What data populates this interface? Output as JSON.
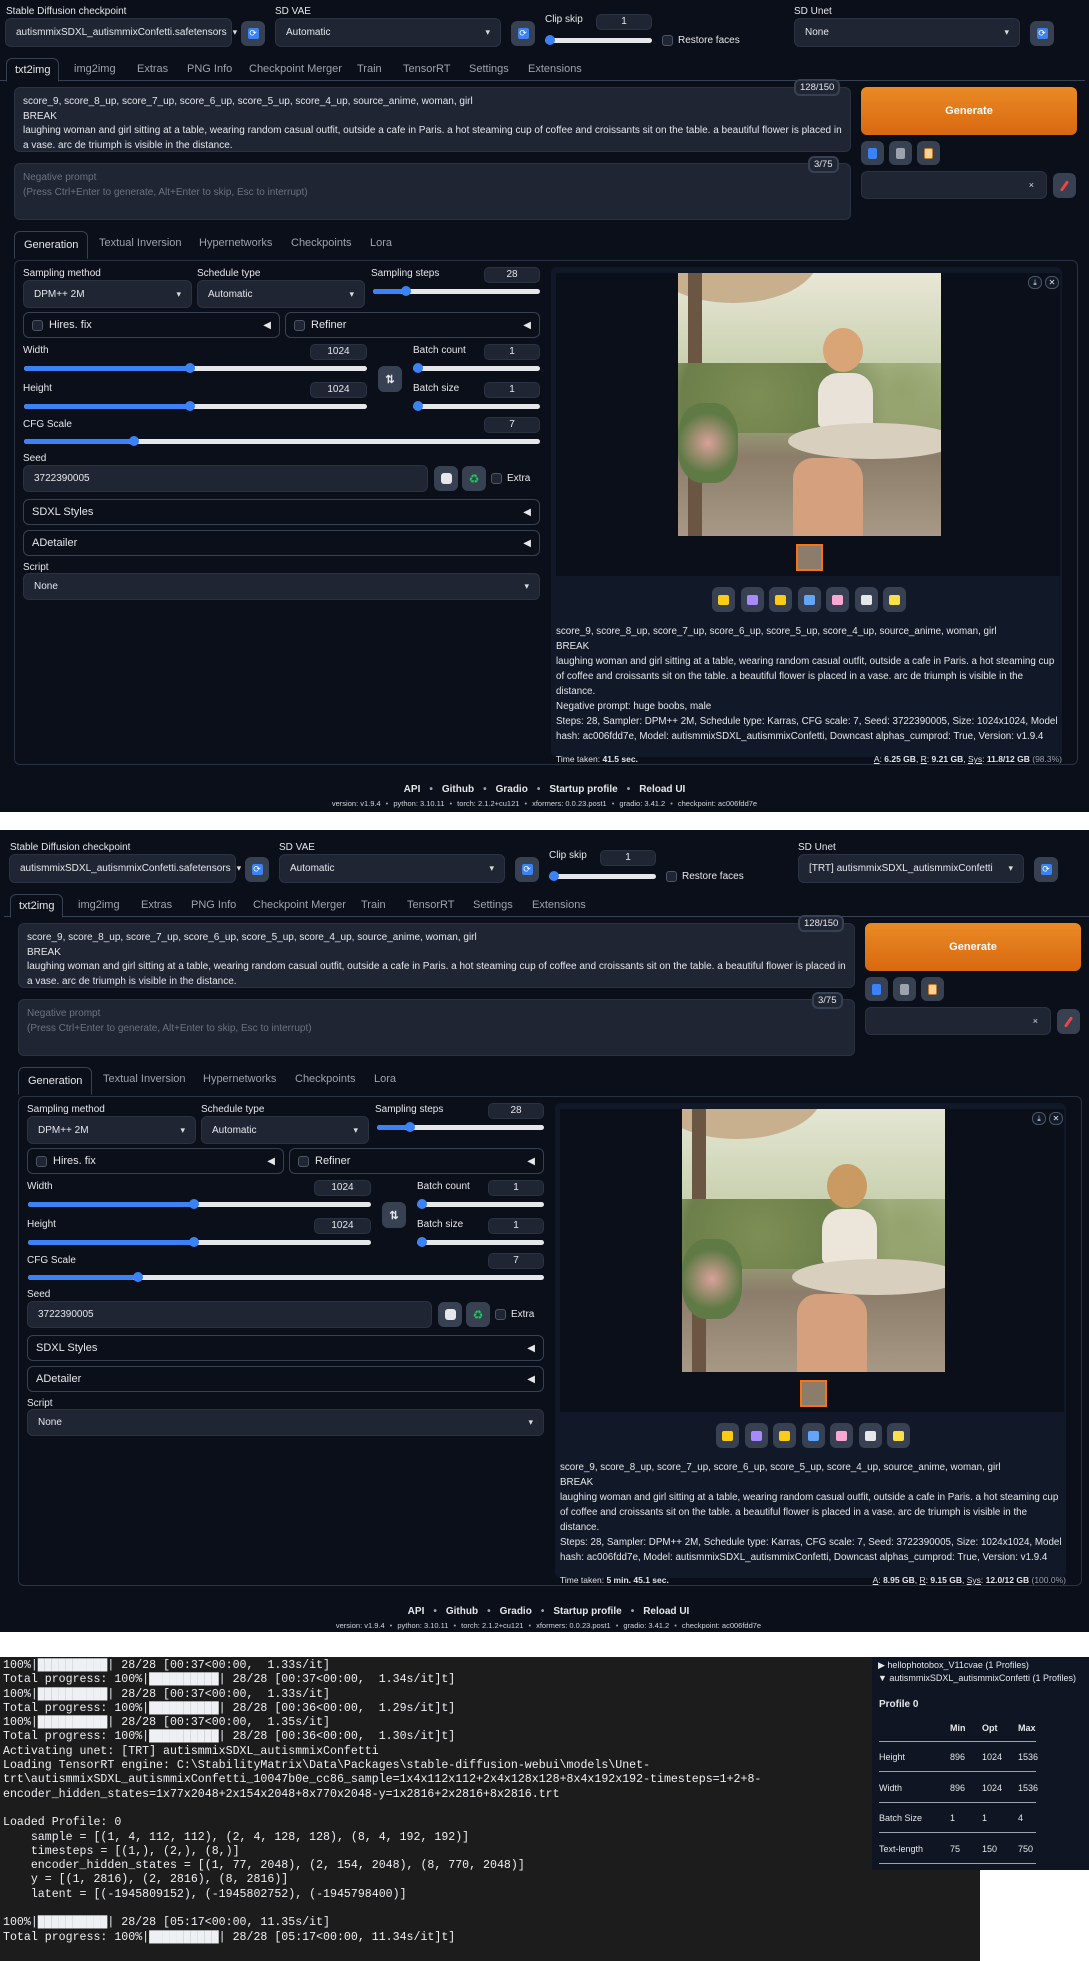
{
  "ui": {
    "checkpoint_label": "Stable Diffusion checkpoint",
    "vae_label": "SD VAE",
    "vae_value": "Automatic",
    "clip_skip_label": "Clip skip",
    "restore_faces_label": "Restore faces",
    "unet_label": "SD Unet",
    "tabs": [
      "txt2img",
      "img2img",
      "Extras",
      "PNG Info",
      "Checkpoint Merger",
      "Train",
      "TensorRT",
      "Settings",
      "Extensions"
    ],
    "prompt_counter": "128/150",
    "negative_counter": "3/75",
    "prompt_lines": [
      "score_9, score_8_up, score_7_up, score_6_up, score_5_up, score_4_up, source_anime, woman, girl",
      "BREAK",
      "laughing woman and girl sitting at a table,  wearing random casual outfit, outside a cafe in Paris. a hot steaming cup of coffee and croissants sit on the table. a beautiful flower is placed in a vase. arc de triumph is visible in the distance."
    ],
    "negative_placeholder_1": "Negative prompt",
    "negative_placeholder_2": "(Press Ctrl+Enter to generate, Alt+Enter to skip, Esc to interrupt)",
    "generate_label": "Generate",
    "style_clear": "×",
    "subtabs": [
      "Generation",
      "Textual Inversion",
      "Hypernetworks",
      "Checkpoints",
      "Lora"
    ],
    "sampling_method_label": "Sampling method",
    "sampling_method_value": "DPM++ 2M",
    "schedule_type_label": "Schedule type",
    "schedule_type_value": "Automatic",
    "sampling_steps_label": "Sampling steps",
    "hires_label": "Hires. fix",
    "refiner_label": "Refiner",
    "width_label": "Width",
    "height_label": "Height",
    "batch_count_label": "Batch count",
    "batch_size_label": "Batch size",
    "cfg_label": "CFG Scale",
    "seed_label": "Seed",
    "seed_value": "3722390005",
    "extra_label": "Extra",
    "sdxl_styles_label": "SDXL Styles",
    "adetailer_label": "ADetailer",
    "script_label": "Script",
    "script_value": "None",
    "time_label": "Time taken:",
    "mem_a": "A",
    "mem_r": "R",
    "mem_sys": "Sys",
    "footer_links": [
      "API",
      "Github",
      "Gradio",
      "Startup profile",
      "Reload UI"
    ],
    "footer_version": [
      "version: v1.9.4",
      "python: 3.10.11",
      "torch: 2.1.2+cu121",
      "xformers: 0.0.23.post1",
      "gradio: 3.41.2",
      "checkpoint: ac006fdd7e"
    ],
    "sliders": {
      "clip_skip": {
        "value": "1",
        "min": 1,
        "max": 12
      },
      "steps": {
        "value": "28",
        "min": 1,
        "max": 150
      },
      "width": {
        "value": "1024",
        "min": 64,
        "max": 2048
      },
      "height": {
        "value": "1024",
        "min": 64,
        "max": 2048
      },
      "batch_count": {
        "value": "1",
        "min": 1,
        "max": 100
      },
      "batch_size": {
        "value": "1",
        "min": 1,
        "max": 8
      },
      "cfg": {
        "value": "7",
        "min": 1,
        "max": 30
      }
    }
  },
  "panels": [
    {
      "checkpoint": "autismmixSDXL_autismmixConfetti.safetensors",
      "unet": "None",
      "info_lines": [
        "score_9, score_8_up, score_7_up, score_6_up, score_5_up, score_4_up, source_anime, woman, girl",
        "BREAK",
        "laughing woman and girl sitting at a table, wearing random casual outfit, outside a cafe in Paris. a hot steaming cup of coffee and croissants sit on the table. a beautiful flower is placed in a vase. arc de triumph is visible in the distance.",
        "Negative prompt: huge boobs, male",
        "Steps: 28, Sampler: DPM++ 2M, Schedule type: Karras, CFG scale: 7, Seed: 3722390005, Size: 1024x1024, Model hash: ac006fdd7e, Model: autismmixSDXL_autismmixConfetti, Downcast alphas_cumprod: True, Version: v1.9.4"
      ],
      "time": "41.5 sec.",
      "mem": {
        "a": "6.25 GB",
        "r": "9.21 GB",
        "sys": "11.8/12 GB",
        "pct": "(98.3%)"
      }
    },
    {
      "checkpoint": "autismmixSDXL_autismmixConfetti.safetensors",
      "unet": "[TRT] autismmixSDXL_autismmixConfetti",
      "info_lines": [
        "score_9, score_8_up, score_7_up, score_6_up, score_5_up, score_4_up, source_anime, woman, girl",
        "BREAK",
        "laughing woman and girl sitting at a table, wearing random casual outfit, outside a cafe in Paris. a hot steaming cup of coffee and croissants sit on the table. a beautiful flower is placed in a vase. arc de triumph is visible in the distance.",
        "Steps: 28, Sampler: DPM++ 2M, Schedule type: Karras, CFG scale: 7, Seed: 3722390005, Size: 1024x1024, Model hash: ac006fdd7e, Model: autismmixSDXL_autismmixConfetti, Downcast alphas_cumprod: True, Version: v1.9.4"
      ],
      "time": "5 min. 45.1 sec.",
      "mem": {
        "a": "8.95 GB",
        "r": "9.15 GB",
        "sys": "12.0/12 GB",
        "pct": "(100.0%)"
      }
    }
  ],
  "terminal": {
    "lines": [
      "100%|██████████| 28/28 [00:37<00:00,  1.33s/it]",
      "Total progress: 100%|██████████| 28/28 [00:37<00:00,  1.34s/it]t]",
      "100%|██████████| 28/28 [00:37<00:00,  1.33s/it]",
      "Total progress: 100%|██████████| 28/28 [00:36<00:00,  1.29s/it]t]",
      "100%|██████████| 28/28 [00:37<00:00,  1.35s/it]",
      "Total progress: 100%|██████████| 28/28 [00:36<00:00,  1.30s/it]t]",
      "Activating unet: [TRT] autismmixSDXL_autismmixConfetti",
      "Loading TensorRT engine: C:\\StabilityMatrix\\Data\\Packages\\stable-diffusion-webui\\models\\Unet-",
      "trt\\autismmixSDXL_autismmixConfetti_10047b0e_cc86_sample=1x4x112x112+2x4x128x128+8x4x192x192-timesteps=1+2+8-",
      "encoder_hidden_states=1x77x2048+2x154x2048+8x770x2048-y=1x2816+2x2816+8x2816.trt",
      "",
      "Loaded Profile: 0",
      "    sample = [(1, 4, 112, 112), (2, 4, 128, 128), (8, 4, 192, 192)]",
      "    timesteps = [(1,), (2,), (8,)]",
      "    encoder_hidden_states = [(1, 77, 2048), (2, 154, 2048), (8, 770, 2048)]",
      "    y = [(1, 2816), (2, 2816), (8, 2816)]",
      "    latent = [(-1945809152), (-1945802752), (-1945798400)]",
      "",
      "100%|██████████| 28/28 [05:17<00:00, 11.35s/it]",
      "Total progress: 100%|██████████| 28/28 [05:17<00:00, 11.34s/it]t]"
    ]
  },
  "profiles": {
    "entries": [
      "▶ hellophotobox_V11cvae (1 Profiles)",
      "▼ autismmixSDXL_autismmixConfetti (1 Profiles)"
    ],
    "title": "Profile 0",
    "headers": [
      "Min",
      "Opt",
      "Max"
    ],
    "rows": [
      {
        "label": "Height",
        "values": [
          "896",
          "1024",
          "1536"
        ]
      },
      {
        "label": "Width",
        "values": [
          "896",
          "1024",
          "1536"
        ]
      },
      {
        "label": "Batch Size",
        "values": [
          "1",
          "1",
          "4"
        ]
      },
      {
        "label": "Text-length",
        "values": [
          "75",
          "150",
          "750"
        ]
      }
    ]
  },
  "colors": {
    "accent": "#3b82f6",
    "generate": "#e57a1a",
    "bg": "#0b0f19"
  }
}
